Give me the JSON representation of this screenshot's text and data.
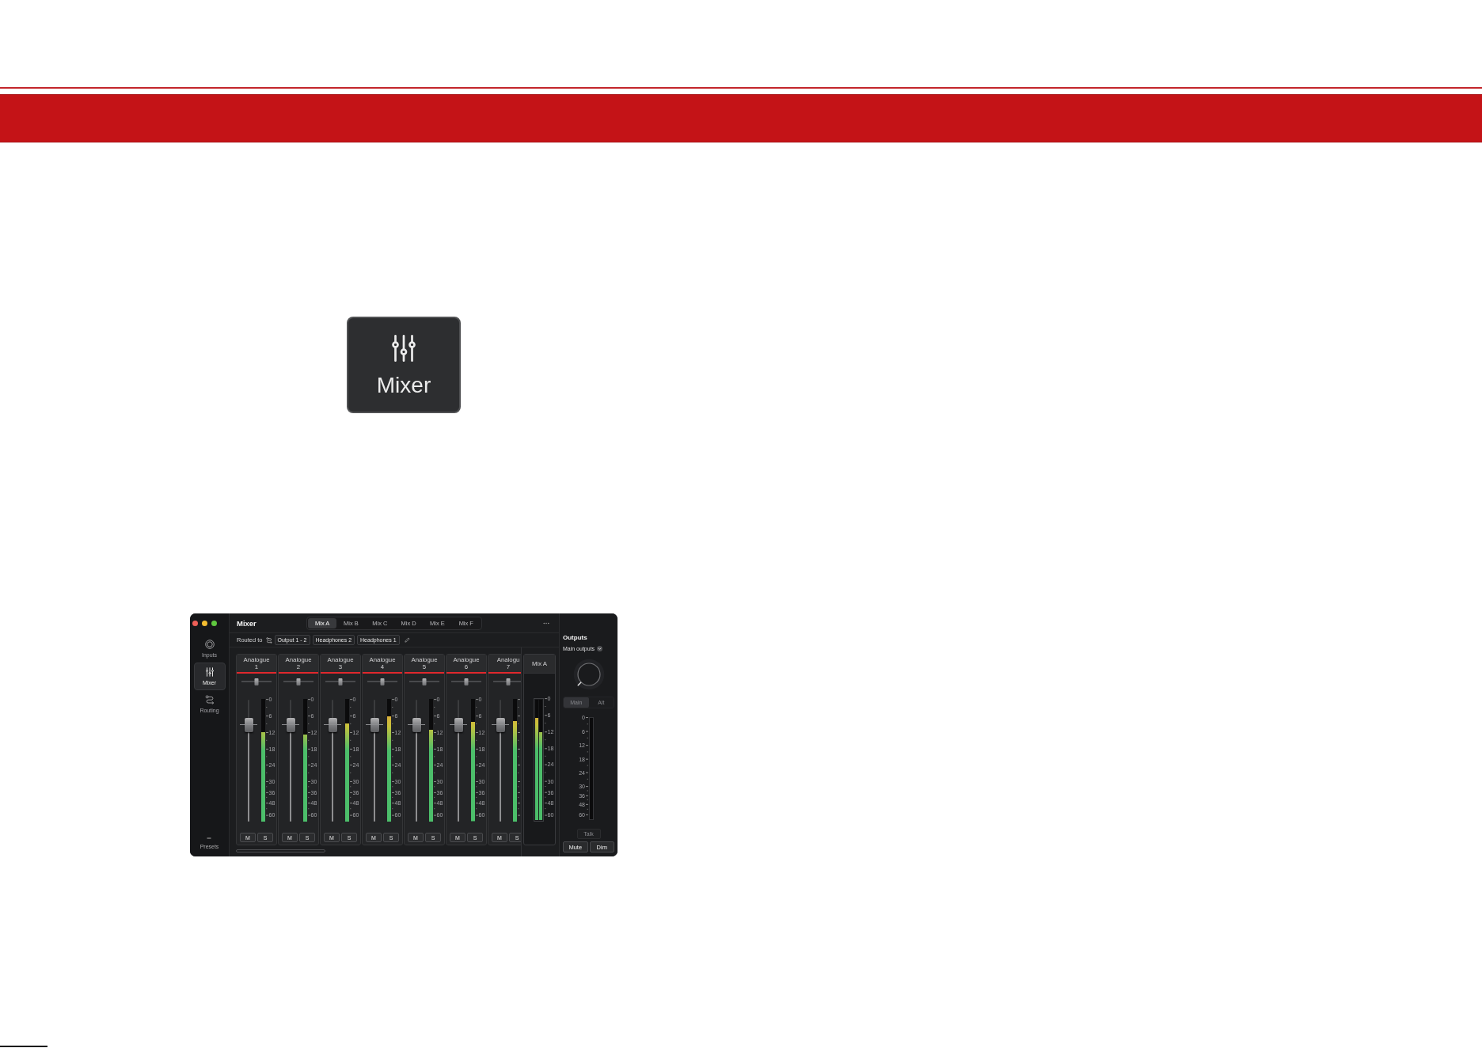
{
  "page_button": {
    "label": "Mixer"
  },
  "app": {
    "title": "Mixer",
    "sidebar": {
      "items": [
        {
          "label": "Inputs",
          "kind": "inputs",
          "selected": false
        },
        {
          "label": "Mixer",
          "kind": "mixer",
          "selected": true
        },
        {
          "label": "Routing",
          "kind": "routing",
          "selected": false
        }
      ],
      "footer": {
        "label": "Presets"
      }
    },
    "mix_tabs": [
      {
        "label": "Mix A",
        "selected": true
      },
      {
        "label": "Mix B",
        "selected": false
      },
      {
        "label": "Mix C",
        "selected": false
      },
      {
        "label": "Mix D",
        "selected": false
      },
      {
        "label": "Mix E",
        "selected": false
      },
      {
        "label": "Mix F",
        "selected": false
      }
    ],
    "routing": {
      "label": "Routed to",
      "destinations": [
        "Output 1 - 2",
        "Headphones 2",
        "Headphones 1"
      ]
    },
    "channels": [
      {
        "name": "Analogue",
        "number": "1",
        "pan": {
          "level": 0.5
        },
        "fader": {
          "level": 0.79
        },
        "meter": {
          "level": 0.73
        },
        "scale": [
          "0",
          "6",
          "12",
          "18",
          "24",
          "30",
          "36",
          "48",
          "60"
        ],
        "mute": "M",
        "solo": "S"
      },
      {
        "name": "Analogue",
        "number": "2",
        "pan": {
          "level": 0.5
        },
        "fader": {
          "level": 0.79
        },
        "meter": {
          "level": 0.71
        },
        "scale": [
          "0",
          "6",
          "12",
          "18",
          "24",
          "30",
          "36",
          "48",
          "60"
        ],
        "mute": "M",
        "solo": "S"
      },
      {
        "name": "Analogue",
        "number": "3",
        "pan": {
          "level": 0.5
        },
        "fader": {
          "level": 0.79
        },
        "meter": {
          "level": 0.8
        },
        "scale": [
          "0",
          "6",
          "12",
          "18",
          "24",
          "30",
          "36",
          "48",
          "60"
        ],
        "mute": "M",
        "solo": "S"
      },
      {
        "name": "Analogue",
        "number": "4",
        "pan": {
          "level": 0.5
        },
        "fader": {
          "level": 0.79
        },
        "meter": {
          "level": 0.86
        },
        "scale": [
          "0",
          "6",
          "12",
          "18",
          "24",
          "30",
          "36",
          "48",
          "60"
        ],
        "mute": "M",
        "solo": "S"
      },
      {
        "name": "Analogue",
        "number": "5",
        "pan": {
          "level": 0.5
        },
        "fader": {
          "level": 0.79
        },
        "meter": {
          "level": 0.75
        },
        "scale": [
          "0",
          "6",
          "12",
          "18",
          "24",
          "30",
          "36",
          "48",
          "60"
        ],
        "mute": "M",
        "solo": "S"
      },
      {
        "name": "Analogue",
        "number": "6",
        "pan": {
          "level": 0.5
        },
        "fader": {
          "level": 0.79
        },
        "meter": {
          "level": 0.81
        },
        "scale": [
          "0",
          "6",
          "12",
          "18",
          "24",
          "30",
          "36",
          "48",
          "60"
        ],
        "mute": "M",
        "solo": "S"
      },
      {
        "name": "Analogu",
        "number": "7",
        "pan": {
          "level": 0.5
        },
        "fader": {
          "level": 0.79
        },
        "meter": {
          "level": 0.82
        },
        "mute": "M",
        "solo": "S"
      }
    ],
    "mix_bus": {
      "name": "Mix A",
      "meters": [
        {
          "level": 0.85
        },
        {
          "level": 0.73
        }
      ],
      "scale": [
        "0",
        "6",
        "12",
        "18",
        "24",
        "30",
        "36",
        "48",
        "60"
      ]
    },
    "outputs": {
      "title": "Outputs",
      "selector": "Main outputs",
      "knob": {
        "level": 0
      },
      "monitor_switch": {
        "disabled": true,
        "options": [
          {
            "label": "Main",
            "selected": true
          },
          {
            "label": "Alt",
            "selected": false
          }
        ]
      },
      "scale": [
        "0",
        "6",
        "12",
        "18",
        "24",
        "30",
        "36",
        "48",
        "60"
      ],
      "talk": {
        "label": "Talk",
        "disabled": true
      },
      "buttons": [
        "Mute",
        "Dim"
      ]
    }
  }
}
